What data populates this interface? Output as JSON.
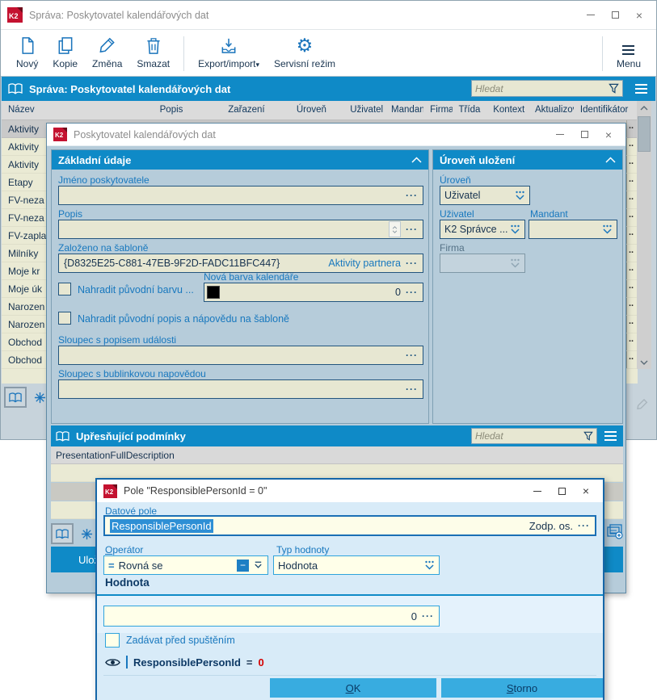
{
  "glyphs": {
    "ellipsis": "···",
    "dropdown_arrow": "▾"
  },
  "colors": {
    "accent_blue": "#0F8AC7",
    "value_red": "#D40000",
    "calendar_color_swatch": "#000000"
  },
  "main_window": {
    "title": "Správa: Poskytovatel kalendářových dat",
    "toolbar": {
      "new": "Nový",
      "copy": "Kopie",
      "edit": "Změna",
      "delete": "Smazat",
      "export": "Export/import",
      "service": "Servisní režim",
      "menu": "Menu"
    },
    "browse": {
      "title": "Správa: Poskytovatel kalendářových dat",
      "search_placeholder": "Hledat",
      "columns": [
        "Název",
        "Popis",
        "Zařazení",
        "Úroveň",
        "Uživatel",
        "Mandant",
        "Firma",
        "Třída",
        "Kontext",
        "Aktualizováno",
        "Identifikátor"
      ],
      "rows": [
        {
          "name": "Aktivity",
          "ident": ".."
        },
        {
          "name": "Aktivity",
          "ident": ".."
        },
        {
          "name": "Aktivity",
          "ident": ".."
        },
        {
          "name": "Etapy",
          "ident": ".."
        },
        {
          "name": "FV-neza",
          "ident": ".."
        },
        {
          "name": "FV-neza",
          "ident": ".."
        },
        {
          "name": "FV-zapla",
          "ident": ".."
        },
        {
          "name": "Milníky",
          "ident": ".."
        },
        {
          "name": "Moje kr",
          "ident": ".."
        },
        {
          "name": "Moje úk",
          "ident": ".."
        },
        {
          "name": "Narozen",
          "ident": ".."
        },
        {
          "name": "Narozen",
          "ident": ".."
        },
        {
          "name": "Obchod",
          "ident": ".."
        },
        {
          "name": "Obchod",
          "ident": ".."
        }
      ]
    }
  },
  "provider_dialog": {
    "title": "Poskytovatel kalendářových dat",
    "basic": {
      "header": "Základní údaje",
      "name_label": "Jméno poskytovatele",
      "desc_label": "Popis",
      "template_label": "Založeno na šabloně",
      "template_guid": "{D8325E25-C881-47EB-9F2D-FADC11BFC447}",
      "template_name": "Aktivity partnera",
      "replace_color_label": "Nahradit původní barvu ...",
      "new_color_label": "Nová barva kalendáře",
      "new_color_value": "0",
      "replace_desc_label": "Nahradit původní popis a nápovědu na šabloně",
      "event_desc_label": "Sloupec s popisem události",
      "tooltip_label": "Sloupec s bublinkovou napovědou"
    },
    "storage": {
      "header": "Úroveň uložení",
      "level_label": "Úroveň",
      "level_value": "Uživatel",
      "user_label": "Uživatel",
      "user_value": "K2 Správce ...",
      "mandant_label": "Mandant",
      "firm_label": "Firma"
    },
    "conditions": {
      "header": "Upřesňující podmínky",
      "search_placeholder": "Hledat",
      "first_row": "PresentationFullDescription",
      "save_label": "Uložit"
    }
  },
  "field_dialog": {
    "title": "Pole \"ResponsiblePersonId = 0\"",
    "data_field_label": "Datové pole",
    "data_field_value": "ResponsiblePersonId",
    "data_field_suffix": "Zodp. os.",
    "operator_label": "Operátor",
    "operator_icon": "=",
    "operator_value": "Rovná se",
    "value_type_label": "Typ hodnoty",
    "value_type_value": "Hodnota",
    "value_section_header": "Hodnota",
    "value": "0",
    "prompt_label": "Zadávat před spuštěním",
    "preview_field": "ResponsiblePersonId",
    "preview_eq": "=",
    "preview_value": "0",
    "ok_label": "OK",
    "cancel_label": "Storno"
  }
}
